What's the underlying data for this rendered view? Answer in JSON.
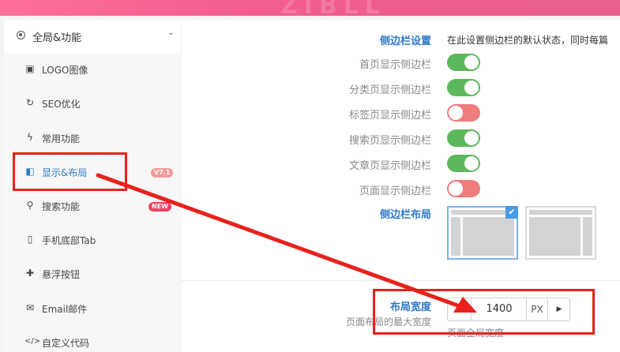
{
  "banner": {
    "ghost_text": "ZIBLL"
  },
  "sidebar": {
    "group": {
      "label": "全局&功能",
      "chevron": "⌄"
    },
    "items": [
      {
        "label": "LOGO图像",
        "icon": "image-icon",
        "glyph": "▣"
      },
      {
        "label": "SEO优化",
        "icon": "refresh-icon",
        "glyph": "↻"
      },
      {
        "label": "常用功能",
        "icon": "bolt-icon",
        "glyph": "ϟ"
      },
      {
        "label": "显示&布局",
        "icon": "layout-icon",
        "glyph": "◧",
        "badge": "V7.1",
        "active": true
      },
      {
        "label": "搜索功能",
        "icon": "search-icon",
        "glyph": "⚲",
        "badge": "NEW"
      },
      {
        "label": "手机底部Tab",
        "icon": "phone-icon",
        "glyph": "▯"
      },
      {
        "label": "悬浮按钮",
        "icon": "pin-icon",
        "glyph": "✚"
      },
      {
        "label": "Email邮件",
        "icon": "mail-icon",
        "glyph": "✉"
      },
      {
        "label": "自定义代码",
        "icon": "code-icon",
        "glyph": "</>"
      }
    ]
  },
  "content": {
    "section_title": "侧边栏设置",
    "section_desc": "在此设置侧边栏的默认状态，同时每篇",
    "toggles": [
      {
        "label": "首页显示侧边栏",
        "on": true
      },
      {
        "label": "分类页显示侧边栏",
        "on": true
      },
      {
        "label": "标签页显示侧边栏",
        "on": false
      },
      {
        "label": "搜索页显示侧边栏",
        "on": true
      },
      {
        "label": "文章页显示侧边栏",
        "on": true
      },
      {
        "label": "页面显示侧边栏",
        "on": false
      }
    ],
    "layout": {
      "label": "侧边栏布局",
      "selected_mark": "✔"
    },
    "width": {
      "label": "布局宽度",
      "sublabel": "页面布局的最大宽度",
      "value": "1400",
      "unit": "PX",
      "dec_glyph": "◀",
      "inc_glyph": "▶",
      "help": "页面全局宽度"
    }
  },
  "colors": {
    "accent_blue": "#2f79c9",
    "toggle_on": "#5cb85c",
    "toggle_off": "#f07d7d",
    "annotation_red": "#e8211c"
  }
}
